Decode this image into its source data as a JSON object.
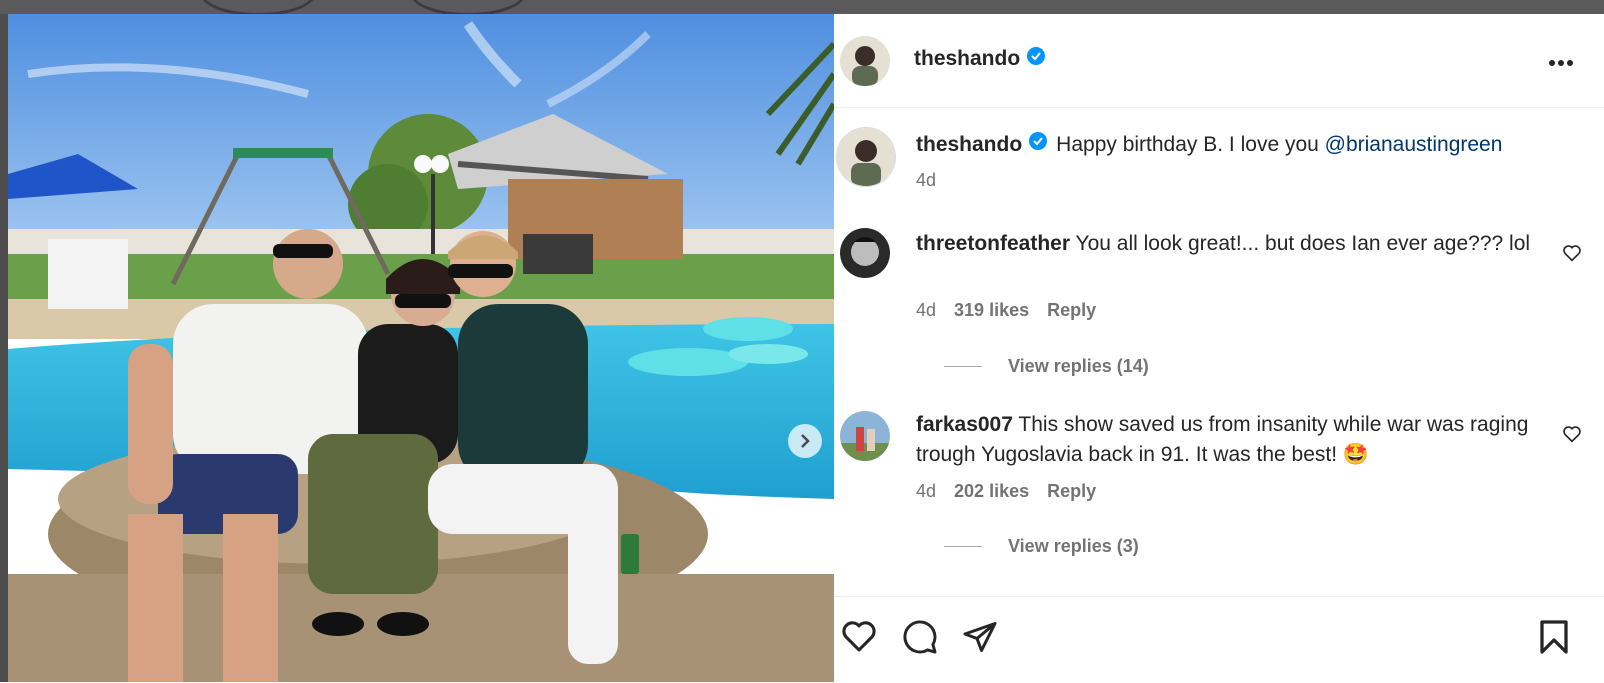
{
  "post": {
    "author": "theshando",
    "verified": true,
    "photo_alt": "",
    "next_icon": "chevron-right-icon",
    "more_icon": "more-horizontal-icon"
  },
  "caption": {
    "username": "theshando",
    "text": "Happy birthday B. I love you ",
    "mention": "@brianaustingreen",
    "time": "4d"
  },
  "comments": [
    {
      "username": "threetonfeather",
      "text": "You all look great!... but does Ian ever age??? lol",
      "time": "4d",
      "likes": "319 likes",
      "reply_label": "Reply",
      "view_replies": "View replies (14)"
    },
    {
      "username": "farkas007",
      "text": "This show saved us from insanity while war was raging trough Yugoslavia back in 91. It was the best!",
      "emoji": "🤩",
      "time": "4d",
      "likes": "202 likes",
      "reply_label": "Reply",
      "view_replies": "View replies (3)"
    }
  ],
  "actions": {
    "icons": [
      "heart-icon",
      "comment-icon",
      "share-icon",
      "bookmark-icon"
    ]
  },
  "colors": {
    "verified": "#0095f6",
    "mention": "#00376b",
    "secondary": "#737373"
  }
}
